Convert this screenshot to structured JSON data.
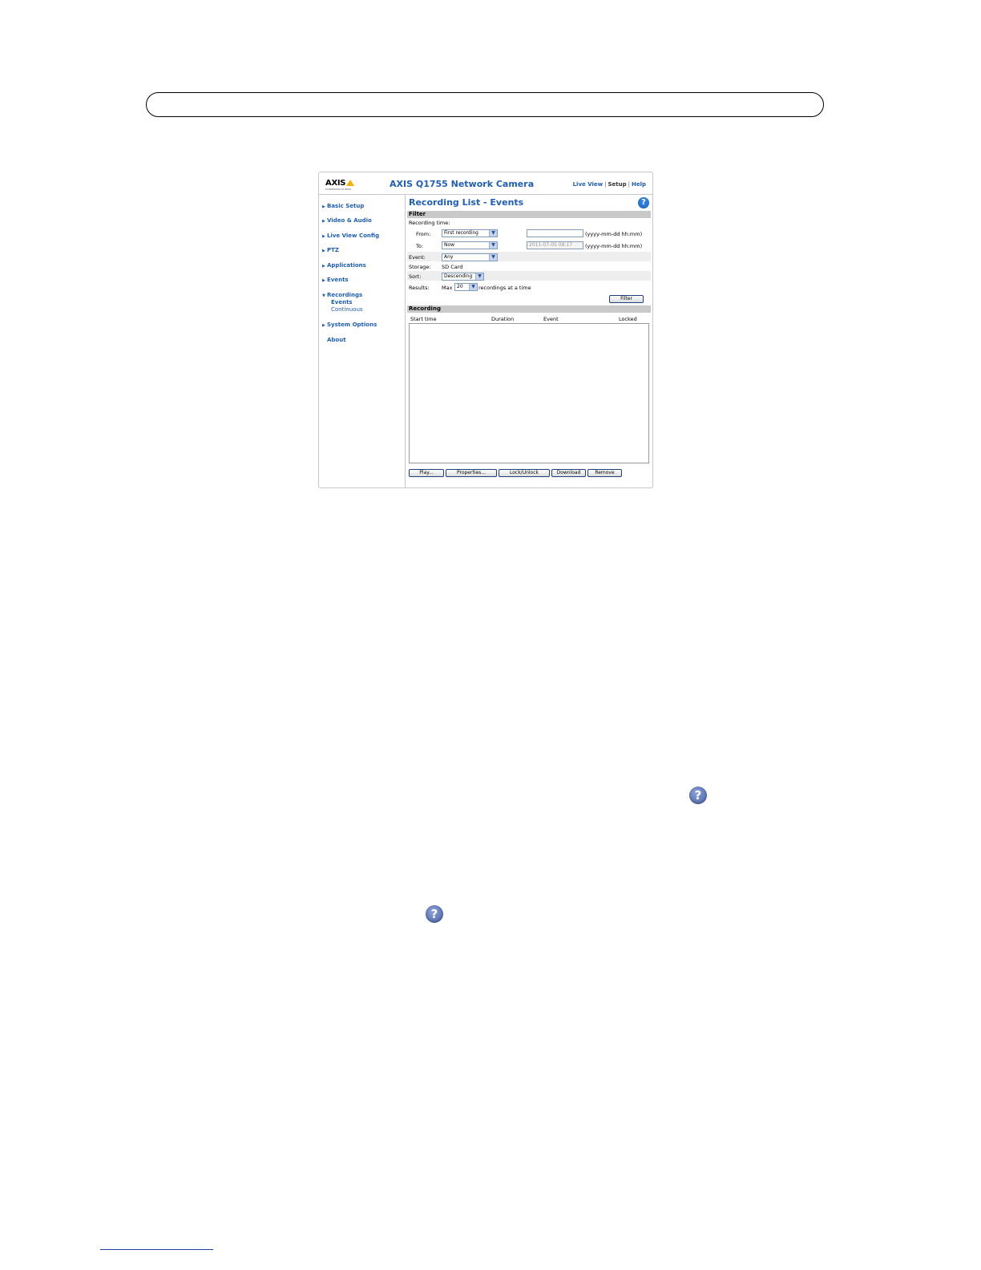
{
  "screenshot": {
    "logo": "AXIS",
    "logo_sub": "COMMUNICATIONS",
    "camera_title": "AXIS Q1755 Network Camera",
    "top_links": [
      "Live View",
      "Setup",
      "Help"
    ],
    "nav": {
      "basic_setup": "Basic Setup",
      "video_audio": "Video & Audio",
      "live_view_config": "Live View Config",
      "ptz": "PTZ",
      "applications": "Applications",
      "events": "Events",
      "recordings": "Recordings",
      "recordings_events": "Events",
      "recordings_continuous": "Continuous",
      "system_options": "System Options",
      "about": "About"
    },
    "page_title": "Recording List - Events",
    "help_glyph": "?",
    "filter": {
      "header": "Filter",
      "recording_time_label": "Recording time:",
      "from_label": "From:",
      "from_value": "First recording",
      "from_text": "",
      "from_format": "(yyyy-mm-dd hh:mm)",
      "to_label": "To:",
      "to_value": "Now",
      "to_text": "2011-07-05 08:17",
      "to_format": "(yyyy-mm-dd hh:mm)",
      "event_label": "Event:",
      "event_value": "Any",
      "storage_label": "Storage:",
      "storage_value": "SD Card",
      "sort_label": "Sort:",
      "sort_value": "Descending",
      "results_label": "Results:",
      "results_max": "Max",
      "results_value": "20",
      "results_suffix": "recordings at a time",
      "filter_button": "Filter"
    },
    "recording": {
      "header": "Recording",
      "columns": [
        "Start time",
        "Duration",
        "Event",
        "Locked"
      ],
      "buttons": {
        "play": "Play...",
        "properties": "Properties...",
        "lock_unlock": "Lock/Unlock",
        "download": "Download",
        "remove": "Remove"
      }
    }
  },
  "page_help_glyph": "?"
}
